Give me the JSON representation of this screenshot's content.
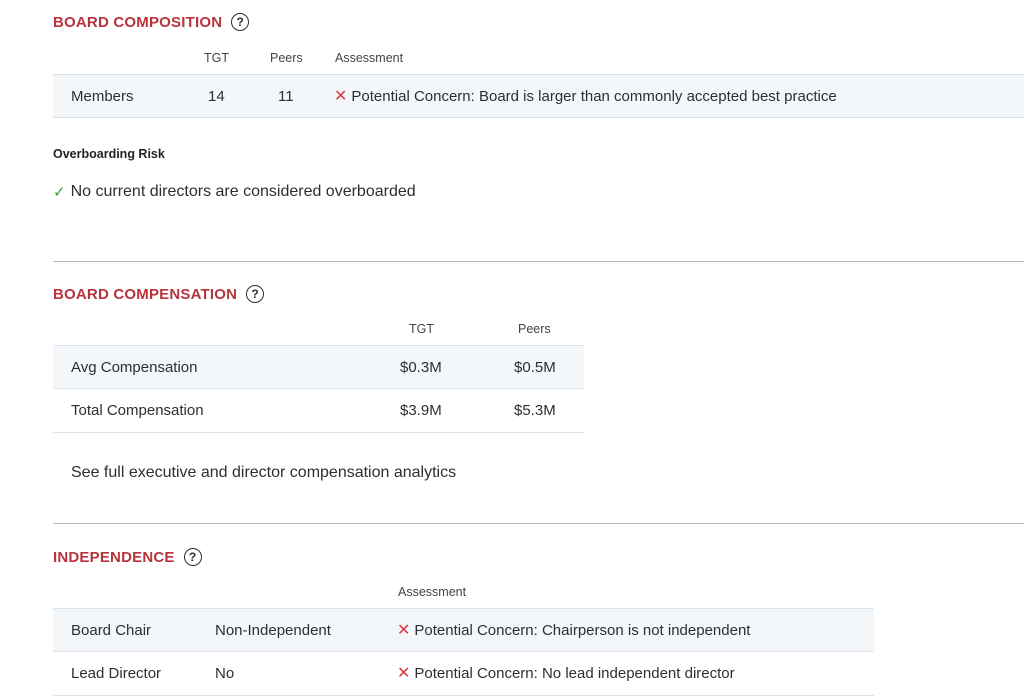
{
  "board_composition": {
    "title": "BOARD COMPOSITION",
    "headers": {
      "tgt": "TGT",
      "peers": "Peers",
      "assessment": "Assessment"
    },
    "rows": [
      {
        "label": "Members",
        "tgt": "14",
        "peers": "11",
        "assessment": "Potential Concern: Board is larger than commonly accepted best practice",
        "status_icon": "x-icon"
      }
    ]
  },
  "overboarding": {
    "title": "Overboarding Risk",
    "status_icon": "check-icon",
    "text": "No current directors are considered overboarded"
  },
  "board_compensation": {
    "title": "BOARD COMPENSATION",
    "headers": {
      "tgt": "TGT",
      "peers": "Peers"
    },
    "rows": [
      {
        "label": "Avg Compensation",
        "tgt": "$0.3M",
        "peers": "$0.5M"
      },
      {
        "label": "Total Compensation",
        "tgt": "$3.9M",
        "peers": "$5.3M"
      }
    ],
    "link_text": "See full executive and director compensation analytics"
  },
  "independence": {
    "title": "INDEPENDENCE",
    "headers": {
      "assessment": "Assessment"
    },
    "rows": [
      {
        "label": "Board Chair",
        "value": "Non-Independent",
        "assessment": "Potential Concern: Chairperson is not independent",
        "status_icon": "x-icon"
      },
      {
        "label": "Lead Director",
        "value": "No",
        "assessment": "Potential Concern: No lead independent director",
        "status_icon": "x-icon"
      }
    ]
  },
  "colors": {
    "accent": "#b8343d",
    "concern": "#d83a3f",
    "ok": "#3a9a3e",
    "row_shade": "#f4f7fa"
  }
}
